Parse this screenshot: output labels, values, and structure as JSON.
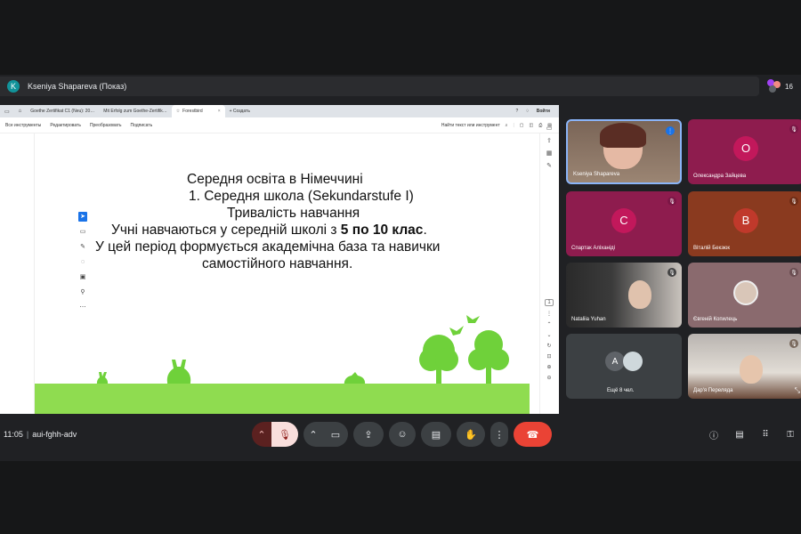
{
  "presenter": {
    "avatar_letter": "K",
    "name": "Kseniya Shapareva (Показ)"
  },
  "people_count": "16",
  "browser": {
    "tabs": [
      {
        "label": "Goethe Zertifikat C1 (Neu): 20…"
      },
      {
        "label": "Mit Erfolg zum Goethe-Zertifik…"
      },
      {
        "label": "Forestbird"
      },
      {
        "label": "+ Создать"
      }
    ],
    "tab_close": "×",
    "right_label": "Войти",
    "toolbar": {
      "items": [
        "Все инструменты",
        "Редактировать",
        "Преобразовать",
        "Подписать"
      ],
      "search_text": "Найти текст или инструмент"
    }
  },
  "slide": {
    "line1": "Середня освіта в Німеччині",
    "line2": "1. Середня школа (Sekundarstufe I)",
    "line3": "Тривалість навчання",
    "line4_pre": "Учні навчаються у середній школі з ",
    "line4_bold": "5 по 10 клас",
    "line4_post": ".",
    "line5": "У цей період формується академічна база та навички",
    "line6": "самостійного навчання."
  },
  "page_number": "1",
  "participants": [
    {
      "name": "Kseniya Shapareva"
    },
    {
      "name": "Олександра Зайцева",
      "letter": "О"
    },
    {
      "name": "Спартак Аліханіді",
      "letter": "С"
    },
    {
      "name": "Віталій Бекзюк",
      "letter": "В"
    },
    {
      "name": "Nataliia Yuhan"
    },
    {
      "name": "Євгеній Копилець"
    },
    {
      "name": "Ещё 8 чел.",
      "letter": "A"
    },
    {
      "name": "Дар'я Переляда"
    }
  ],
  "meeting": {
    "time": "11:05",
    "code": "aui-fghh-adv"
  },
  "colors": {
    "accent_blue": "#8ab4f8",
    "end_call": "#ea4335",
    "tile_pink": "#8e1c4e",
    "grass": "#8fdc50"
  }
}
